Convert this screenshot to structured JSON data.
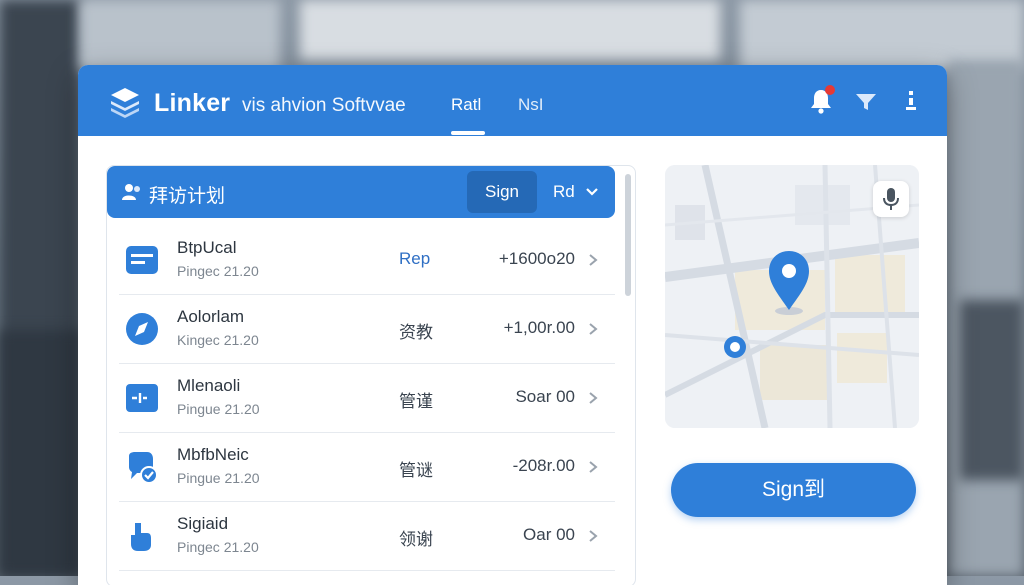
{
  "app": {
    "brand": "Linker",
    "brand_sub": "vis ahvion Softvvae",
    "tabs": [
      {
        "label": "Ratl",
        "active": true
      },
      {
        "label": "NsI",
        "active": false
      }
    ],
    "accent_color": "#2f7fd9",
    "header_icons": [
      "bell-icon",
      "funnel-icon",
      "more-icon"
    ]
  },
  "list": {
    "title": "拜访计划",
    "sign_label": "Sign",
    "filter_label": "Rd",
    "rows": [
      {
        "name": "BtpUcal",
        "sub": "Pingec 21.20",
        "status": "Rep",
        "amount": "+1600o20",
        "icon": "card-icon"
      },
      {
        "name": "Aolorlam",
        "sub": "Kingec 21.20",
        "status": "资教",
        "amount": "+1,00r.00",
        "icon": "compass-icon"
      },
      {
        "name": "Mlenaoli",
        "sub": "Pingue 21.20",
        "status": "管谨",
        "amount": "Soar 00",
        "icon": "pulse-icon"
      },
      {
        "name": "MbfbNeic",
        "sub": "Pingue 21.20",
        "status": "管谜",
        "amount": "-208r.00",
        "icon": "chat-check-icon"
      },
      {
        "name": "Sigiaid",
        "sub": "Pingec 21.20",
        "status": "领谢",
        "amount": "Oar 00",
        "icon": "hand-icon"
      }
    ]
  },
  "map": {
    "pin_icon": "location-pin-icon",
    "mic_icon": "microphone-icon"
  },
  "actions": {
    "sign_in_label": "Sign到"
  }
}
